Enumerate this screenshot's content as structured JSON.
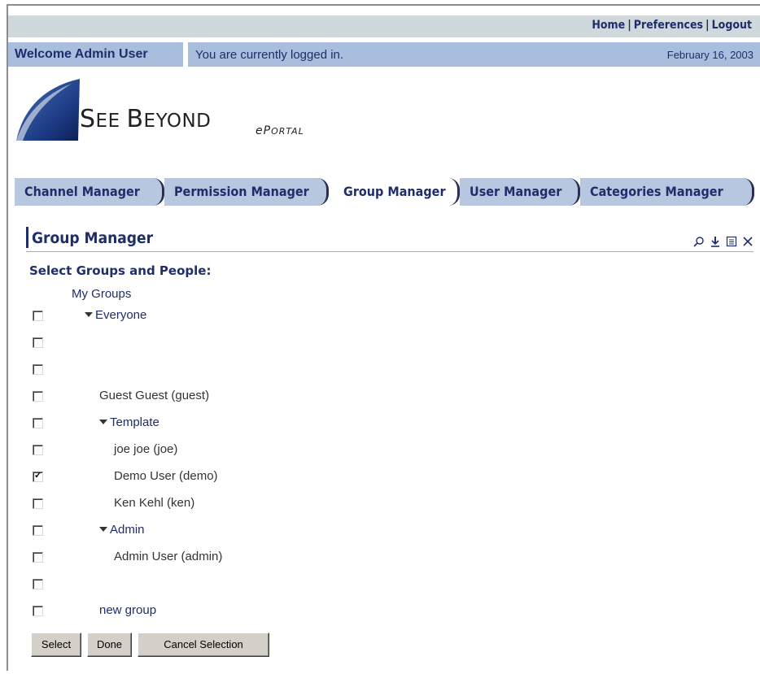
{
  "header": {
    "links": [
      "Home",
      "Preferences",
      "Logout"
    ],
    "welcome": "Welcome Admin User",
    "status_message": "You are currently logged in.",
    "date": "February 16, 2003"
  },
  "logo": {
    "see": "S",
    "see_small": "EE ",
    "beyond": "B",
    "beyond_small": "EYOND",
    "eportal": "eP",
    "eportal_small": "ORTAL"
  },
  "tabs": [
    {
      "label": "Channel Manager",
      "active": false
    },
    {
      "label": "Permission Manager",
      "active": false
    },
    {
      "label": "Group Manager",
      "active": true
    },
    {
      "label": "User Manager",
      "active": false
    },
    {
      "label": "Categories Manager",
      "active": false
    }
  ],
  "portlet": {
    "title": "Group Manager",
    "icons": [
      "zoom-icon",
      "download-icon",
      "edit-icon",
      "close-icon"
    ]
  },
  "selection": {
    "heading": "Select Groups and People:",
    "root_label": "My Groups",
    "rows": [
      {
        "label": "Everyone",
        "type": "group",
        "checked": false
      },
      {
        "label": "",
        "type": "blank",
        "checked": false
      },
      {
        "label": "",
        "type": "blank",
        "checked": false
      },
      {
        "label": "Guest Guest (guest)",
        "type": "user",
        "checked": false
      },
      {
        "label": "Template",
        "type": "group",
        "checked": false
      },
      {
        "label": "joe joe (joe)",
        "type": "user",
        "checked": false
      },
      {
        "label": "Demo User (demo)",
        "type": "user",
        "checked": true
      },
      {
        "label": "Ken Kehl (ken)",
        "type": "user",
        "checked": false
      },
      {
        "label": "Admin",
        "type": "group",
        "checked": false
      },
      {
        "label": "Admin User (admin)",
        "type": "user",
        "checked": false
      },
      {
        "label": "",
        "type": "blank",
        "checked": false
      },
      {
        "label": "new group",
        "type": "group-leaf",
        "checked": false
      }
    ]
  },
  "buttons": {
    "select": "Select",
    "done": "Done",
    "cancel": "Cancel Selection"
  }
}
